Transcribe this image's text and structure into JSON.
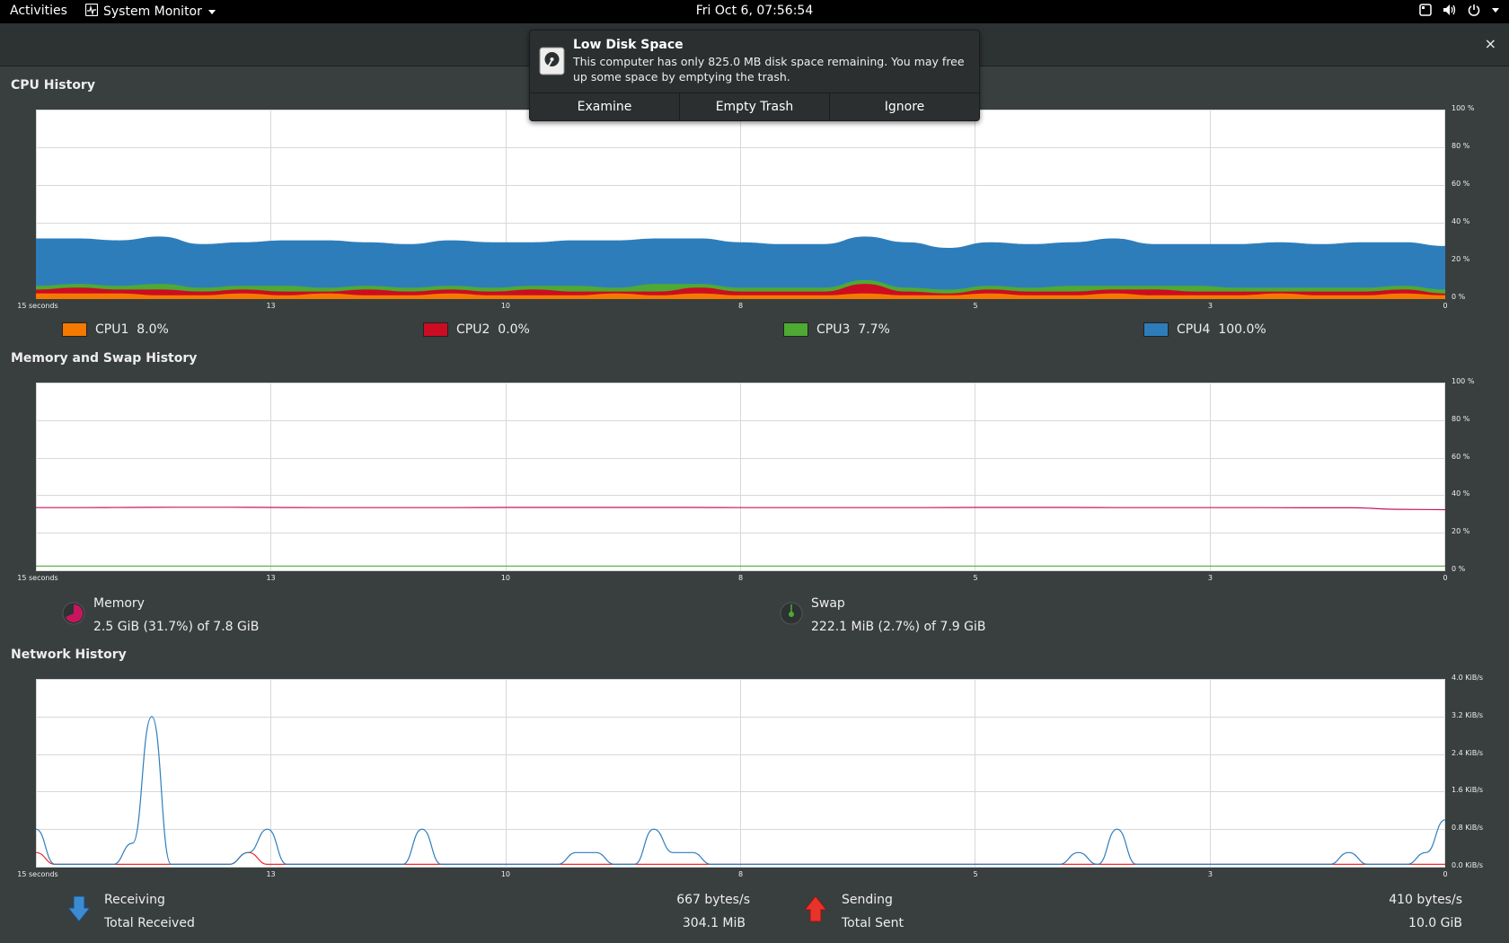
{
  "topbar": {
    "activities": "Activities",
    "app_menu": "System Monitor",
    "clock": "Fri Oct  6, 07:56:54",
    "tray_icons": [
      "screen-icon",
      "volume-icon",
      "power-icon",
      "chevron-down-icon"
    ]
  },
  "notification": {
    "title": "Low Disk Space",
    "body": "This computer has only 825.0 MB disk space remaining.  You may free up some space by emptying the trash.",
    "buttons": [
      "Examine",
      "Empty Trash",
      "Ignore"
    ]
  },
  "window": {
    "close_glyph": "×"
  },
  "cpu": {
    "title": "CPU History",
    "x_ticks": [
      "15 seconds",
      "13",
      "10",
      "8",
      "5",
      "3",
      "0"
    ],
    "y_ticks": [
      "100 %",
      "80 %",
      "60 %",
      "40 %",
      "20 %",
      "0 %"
    ],
    "legend": [
      {
        "name": "CPU1",
        "value": "8.0%",
        "color": "#f57900"
      },
      {
        "name": "CPU2",
        "value": "0.0%",
        "color": "#cc0c22"
      },
      {
        "name": "CPU3",
        "value": "7.7%",
        "color": "#4eaa32"
      },
      {
        "name": "CPU4",
        "value": "100.0%",
        "color": "#2e7dbb"
      }
    ]
  },
  "memory": {
    "title": "Memory and Swap History",
    "x_ticks": [
      "15 seconds",
      "13",
      "10",
      "8",
      "5",
      "3",
      "0"
    ],
    "y_ticks": [
      "100 %",
      "80 %",
      "60 %",
      "40 %",
      "20 %",
      "0 %"
    ],
    "memory_label": "Memory",
    "memory_value": "2.5 GiB (31.7%) of 7.8 GiB",
    "memory_color": "#c7165e",
    "swap_label": "Swap",
    "swap_value": "222.1 MiB (2.7%) of 7.9 GiB",
    "swap_color": "#4eaa32"
  },
  "network": {
    "title": "Network History",
    "x_ticks": [
      "15 seconds",
      "13",
      "10",
      "8",
      "5",
      "3",
      "0"
    ],
    "y_ticks": [
      "4.0 KiB/s",
      "3.2 KiB/s",
      "2.4 KiB/s",
      "1.6 KiB/s",
      "0.8 KiB/s",
      "0.0 KiB/s"
    ],
    "receiving_label": "Receiving",
    "receiving_value": "667 bytes/s",
    "total_received_label": "Total Received",
    "total_received_value": "304.1 MiB",
    "sending_label": "Sending",
    "sending_value": "410 bytes/s",
    "total_sent_label": "Total Sent",
    "total_sent_value": "10.0 GiB",
    "receiving_color": "#2e7dbb",
    "sending_color": "#ef2929"
  },
  "chart_data": [
    {
      "type": "area",
      "title": "CPU History",
      "xlabel": "",
      "ylabel": "",
      "x_ticks": [
        "15 seconds",
        "13",
        "10",
        "8",
        "5",
        "3",
        "0"
      ],
      "ylim": [
        0,
        100
      ],
      "stacked": true,
      "series": [
        {
          "name": "CPU1",
          "values": [
            3,
            3,
            3,
            2,
            2,
            3,
            2,
            3,
            2,
            2,
            3,
            2,
            2,
            2,
            3,
            2,
            3,
            2,
            2,
            2,
            3,
            2,
            2,
            3,
            2,
            2,
            3,
            2,
            2,
            2,
            3,
            2,
            2,
            3,
            2
          ]
        },
        {
          "name": "CPU2",
          "values": [
            2,
            3,
            2,
            3,
            2,
            2,
            2,
            1,
            3,
            2,
            2,
            2,
            3,
            2,
            1,
            2,
            3,
            2,
            2,
            2,
            5,
            2,
            1,
            2,
            2,
            2,
            2,
            3,
            2,
            2,
            1,
            2,
            2,
            2,
            1
          ]
        },
        {
          "name": "CPU3",
          "values": [
            2,
            2,
            2,
            3,
            2,
            2,
            3,
            2,
            2,
            2,
            2,
            2,
            2,
            3,
            2,
            4,
            2,
            2,
            2,
            2,
            2,
            2,
            2,
            2,
            2,
            3,
            2,
            2,
            3,
            2,
            2,
            2,
            2,
            2,
            2
          ]
        },
        {
          "name": "CPU4",
          "values": [
            25,
            24,
            24,
            25,
            23,
            23,
            24,
            25,
            23,
            23,
            24,
            24,
            23,
            24,
            25,
            24,
            24,
            24,
            23,
            23,
            23,
            24,
            22,
            23,
            23,
            23,
            25,
            22,
            22,
            23,
            24,
            23,
            24,
            23,
            23
          ]
        }
      ]
    },
    {
      "type": "line",
      "title": "Memory and Swap History",
      "xlabel": "",
      "ylabel": "",
      "x_ticks": [
        "15 seconds",
        "13",
        "10",
        "8",
        "5",
        "3",
        "0"
      ],
      "ylim": [
        0,
        100
      ],
      "series": [
        {
          "name": "Memory",
          "values": [
            33.7,
            33.7,
            33.8,
            33.9,
            33.9,
            33.8,
            33.7,
            33.7,
            33.7,
            33.7,
            33.8,
            33.8,
            33.8,
            33.8,
            33.8,
            33.7,
            33.7,
            33.7,
            33.7,
            33.7,
            33.8,
            33.8,
            33.8,
            33.7,
            33.7,
            33.7,
            33.7,
            33.6,
            33.6,
            32.8,
            32.6
          ]
        },
        {
          "name": "Swap",
          "values": [
            2.7,
            2.7,
            2.7,
            2.7,
            2.7,
            2.7,
            2.7,
            2.7,
            2.7,
            2.7,
            2.7,
            2.7,
            2.7,
            2.7,
            2.7,
            2.7,
            2.7,
            2.7,
            2.7,
            2.7,
            2.7,
            2.7,
            2.7,
            2.7,
            2.7,
            2.7,
            2.7,
            2.7,
            2.7,
            2.7,
            2.7
          ]
        }
      ]
    },
    {
      "type": "line",
      "title": "Network History",
      "xlabel": "",
      "ylabel": "",
      "x_ticks": [
        "15 seconds",
        "13",
        "10",
        "8",
        "5",
        "3",
        "0"
      ],
      "ylim": [
        0,
        4.0
      ],
      "series": [
        {
          "name": "Receiving",
          "values": [
            0.8,
            0.05,
            0.05,
            0.05,
            0.05,
            0.5,
            3.2,
            0.05,
            0.05,
            0.05,
            0.05,
            0.3,
            0.8,
            0.05,
            0.05,
            0.05,
            0.05,
            0.05,
            0.05,
            0.05,
            0.8,
            0.05,
            0.05,
            0.05,
            0.05,
            0.05,
            0.05,
            0.05,
            0.3,
            0.3,
            0.05,
            0.05,
            0.8,
            0.3,
            0.3,
            0.05,
            0.05,
            0.05,
            0.05,
            0.05,
            0.05,
            0.05,
            0.05,
            0.05,
            0.05,
            0.05,
            0.05,
            0.05,
            0.05,
            0.05,
            0.05,
            0.05,
            0.05,
            0.05,
            0.3,
            0.05,
            0.8,
            0.05,
            0.05,
            0.05,
            0.05,
            0.05,
            0.05,
            0.05,
            0.05,
            0.05,
            0.05,
            0.05,
            0.3,
            0.05,
            0.05,
            0.05,
            0.3,
            1.0
          ]
        },
        {
          "name": "Sending",
          "values": [
            0.3,
            0.05,
            0.05,
            0.05,
            0.05,
            0.05,
            0.05,
            0.05,
            0.05,
            0.05,
            0.05,
            0.3,
            0.05,
            0.05,
            0.05,
            0.05,
            0.05,
            0.05,
            0.05,
            0.05,
            0.05,
            0.05,
            0.05,
            0.05,
            0.05,
            0.05,
            0.05,
            0.05,
            0.05,
            0.05,
            0.05,
            0.05,
            0.05,
            0.05,
            0.05,
            0.05,
            0.05,
            0.05,
            0.05,
            0.05,
            0.05,
            0.05,
            0.05,
            0.05,
            0.05,
            0.05,
            0.05,
            0.05,
            0.05,
            0.05,
            0.05,
            0.05,
            0.05,
            0.05,
            0.05,
            0.05,
            0.05,
            0.05,
            0.05,
            0.05,
            0.05,
            0.05,
            0.05,
            0.05,
            0.05,
            0.05,
            0.05,
            0.05,
            0.05,
            0.05,
            0.05,
            0.05,
            0.05,
            0.05
          ]
        }
      ]
    }
  ]
}
